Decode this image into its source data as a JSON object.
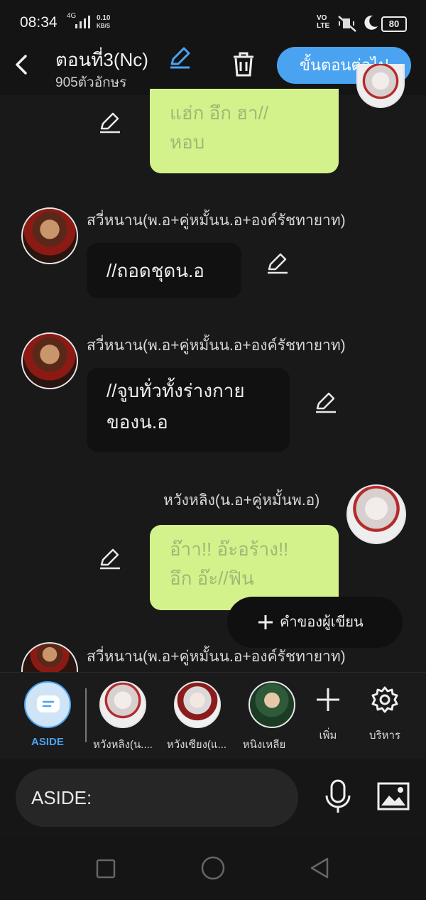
{
  "status_bar": {
    "time": "08:34",
    "network": "4G",
    "speed_value": "0.10",
    "speed_unit": "KB/S",
    "volte_top": "VO",
    "volte_bottom": "LTE",
    "battery": "80"
  },
  "header": {
    "title": "ตอนที่3(Nc)",
    "char_count": "905ตัวอักษร",
    "next_button": "ขั้นตอนต่อไป"
  },
  "messages": [
    {
      "side": "right",
      "lines": [
        "แฮ่ก อึก ฮา//",
        "หอบ"
      ]
    },
    {
      "side": "left",
      "name": "สวี่หนาน(พ.อ+คู่หมั้นน.อ+องค์รัชทายาท)",
      "text": "//ถอดชุดน.อ"
    },
    {
      "side": "left",
      "name": "สวี่หนาน(พ.อ+คู่หมั้นน.อ+องค์รัชทายาท)",
      "lines": [
        "//จูบทั่วทั้งร่างกาย",
        "ของน.อ"
      ]
    },
    {
      "side": "right",
      "name": "หวังหลิง(น.อ+คู่หมั้นพ.อ)",
      "lines": [
        "อ๊าา!! อ๊ะอร้าง!!",
        "อึก อ๊ะ//ฟิน"
      ]
    },
    {
      "side": "left",
      "name": "สวี่หนาน(พ.อ+คู่หมั้นน.อ+องค์รัชทายาท)"
    }
  ],
  "fab_label": "คำของผู้เขียน",
  "characters": {
    "aside": "ASIDE",
    "items": [
      "หวังหลิง(น....",
      "หวังเซียง(แ...",
      "หนิงเหลีย"
    ],
    "add": "เพิ่ม",
    "manage": "บริหาร"
  },
  "input": {
    "placeholder": "ASIDE:"
  },
  "colors": {
    "accent": "#4aa3f0",
    "bubble_green": "#d4f28c",
    "background": "#191919"
  }
}
